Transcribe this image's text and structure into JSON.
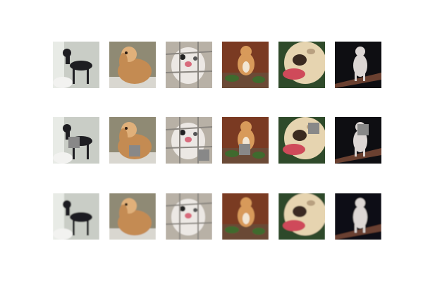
{
  "grid": {
    "rows": [
      "original",
      "occluded",
      "reconstructed"
    ],
    "columns": [
      {
        "subject": "black-dog",
        "bg": "#c9cdc6",
        "fg": "#1e1e22",
        "accent": "#f2f2f0"
      },
      {
        "subject": "spaniel",
        "bg": "#8f8a74",
        "fg": "#c48b52",
        "accent": "#e0b07a"
      },
      {
        "subject": "white-cat",
        "bg": "#b8b1a6",
        "fg": "#ece8e4",
        "accent": "#d86b7c"
      },
      {
        "subject": "orange-cat",
        "bg": "#7a3a22",
        "fg": "#d89a5a",
        "accent": "#3f6a2e"
      },
      {
        "subject": "bulldog",
        "bg": "#2f4a2a",
        "fg": "#e6d4b0",
        "accent": "#cf4a5a"
      },
      {
        "subject": "cat-on-ledge",
        "bg": "#0e0e12",
        "fg": "#dcd6d4",
        "accent": "#6a4030"
      }
    ],
    "patch_color": "#888888"
  }
}
